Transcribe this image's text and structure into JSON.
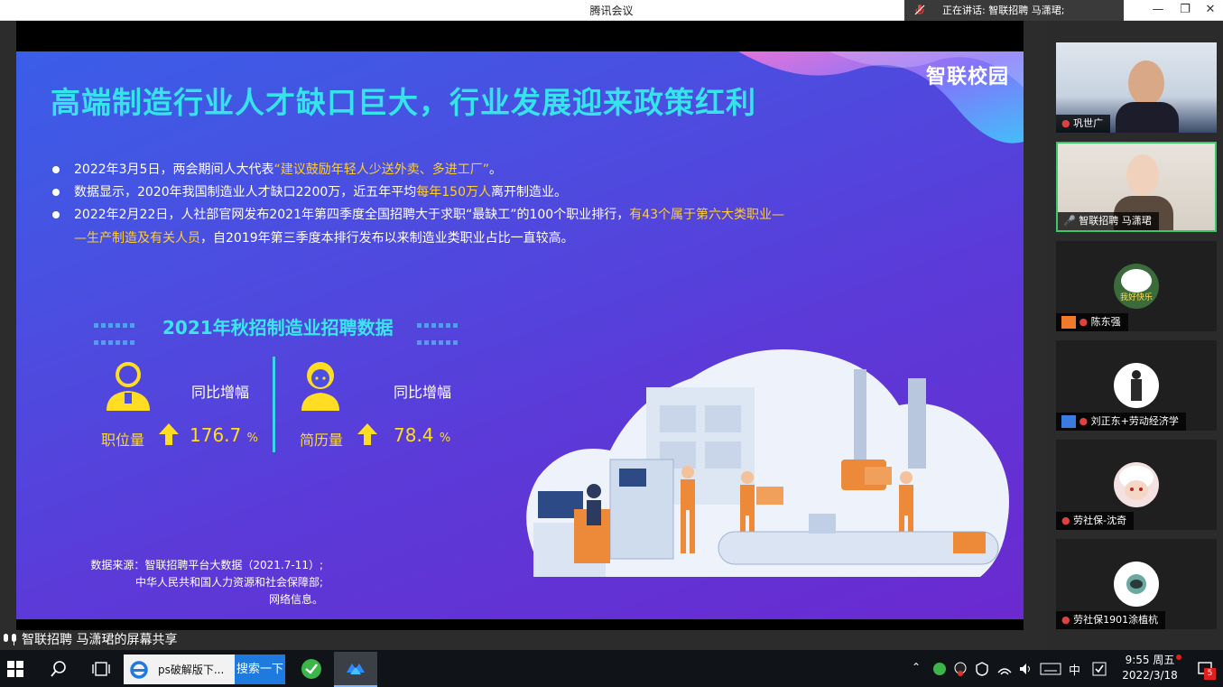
{
  "window": {
    "title": "腾讯会议",
    "speaking_indicator": "正在讲话: 智联招聘 马潇珺;"
  },
  "slide": {
    "title": "高端制造行业人才缺口巨大，行业发展迎来政策红利",
    "brand": "智联校园",
    "bullets": [
      {
        "pre": "2022年3月5日，两会期间人大代表",
        "hl": "“建议鼓励年轻人少送外卖、多进工厂”",
        "post": "。"
      },
      {
        "pre": "数据显示，2020年我国制造业人才缺口2200万，近五年平均",
        "hl": "每年150万人",
        "post": "离开制造业。"
      },
      {
        "pre": "2022年2月22日，人社部官网发布2021年第四季度全国招聘大于求职“最缺工”的100个职业排行，",
        "hl": "有43个属于第六大类职业—",
        "line2_hl": "—生产制造及有关人员",
        "post": "，自2019年第三季度本排行发布以来制造业类职业占比一直较高。"
      }
    ],
    "section_title": "2021年秋招制造业招聘数据",
    "metrics": [
      {
        "yoy_label": "同比增幅",
        "label": "职位量",
        "value": "176.7",
        "unit": "%"
      },
      {
        "yoy_label": "同比增幅",
        "label": "简历量",
        "value": "78.4",
        "unit": "%"
      }
    ],
    "source_lines": [
      "数据来源：智联招聘平台大数据（2021.7-11）;",
      "中华人民共和国人力资源和社会保障部;",
      "网络信息。"
    ]
  },
  "share_label": "智联招聘 马潇珺的屏幕共享",
  "participants": [
    {
      "name": "巩世广"
    },
    {
      "name": "智联招聘 马潇珺"
    },
    {
      "name": "陈东强",
      "avatar_text": "我好快乐"
    },
    {
      "name": "刘正东+劳动经济学"
    },
    {
      "name": "劳社保-沈奇"
    },
    {
      "name": "劳社保1901涂植杭"
    }
  ],
  "taskbar": {
    "task_label": "ps破解版下...",
    "search_label": "搜索一下",
    "ime": "中",
    "time": "9:55 周五",
    "date": "2022/3/18",
    "notification_count": "5"
  }
}
